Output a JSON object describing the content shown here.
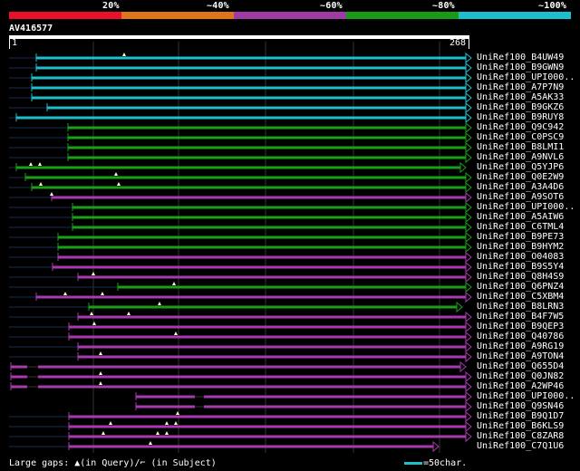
{
  "legend": {
    "labels": [
      "20%",
      "~40%",
      "~60%",
      "~80%",
      "~100%"
    ],
    "colors": [
      "#e8102a",
      "#e07418",
      "#a03aa4",
      "#189c18",
      "#1ebfcc"
    ]
  },
  "query": {
    "title": "AV416577",
    "start": "1",
    "end": "268"
  },
  "hits": [
    {
      "label": "UniRef100_B4UW49",
      "color": "cyan"
    },
    {
      "label": "UniRef100_B9GWN9",
      "color": "cyan"
    },
    {
      "label": "UniRef100_UPI000..",
      "color": "cyan"
    },
    {
      "label": "UniRef100_A7P7N9",
      "color": "cyan"
    },
    {
      "label": "UniRef100_A5AK33",
      "color": "cyan"
    },
    {
      "label": "UniRef100_B9GKZ6",
      "color": "cyan"
    },
    {
      "label": "UniRef100_B9RUY8",
      "color": "cyan"
    },
    {
      "label": "UniRef100_Q9C942",
      "color": "green"
    },
    {
      "label": "UniRef100_C0PSC9",
      "color": "green"
    },
    {
      "label": "UniRef100_B8LMI1",
      "color": "green"
    },
    {
      "label": "UniRef100_A9NVL6",
      "color": "green"
    },
    {
      "label": "UniRef100_Q5YJP6",
      "color": "green"
    },
    {
      "label": "UniRef100_Q0E2W9",
      "color": "green"
    },
    {
      "label": "UniRef100_A3A4D6",
      "color": "green"
    },
    {
      "label": "UniRef100_A9SOT6",
      "color": "purple"
    },
    {
      "label": "UniRef100_UPI000..",
      "color": "green"
    },
    {
      "label": "UniRef100_A5AIW6",
      "color": "green"
    },
    {
      "label": "UniRef100_C6TML4",
      "color": "green"
    },
    {
      "label": "UniRef100_B9PE73",
      "color": "green"
    },
    {
      "label": "UniRef100_B9HYM2",
      "color": "green"
    },
    {
      "label": "UniRef100_O04083",
      "color": "purple"
    },
    {
      "label": "UniRef100_B9S5Y4",
      "color": "purple"
    },
    {
      "label": "UniRef100_Q8H4S9",
      "color": "purple"
    },
    {
      "label": "UniRef100_Q6PNZ4",
      "color": "green"
    },
    {
      "label": "UniRef100_C5XBM4",
      "color": "purple"
    },
    {
      "label": "UniRef100_B8LRN3",
      "color": "green"
    },
    {
      "label": "UniRef100_B4F7W5",
      "color": "purple"
    },
    {
      "label": "UniRef100_B9QEP3",
      "color": "purple"
    },
    {
      "label": "UniRef100_Q40786",
      "color": "purple"
    },
    {
      "label": "UniRef100_A9RG19",
      "color": "purple"
    },
    {
      "label": "UniRef100_A9TON4",
      "color": "purple"
    },
    {
      "label": "UniRef100_Q655D4",
      "color": "purple"
    },
    {
      "label": "UniRef100_Q0JN82",
      "color": "purple"
    },
    {
      "label": "UniRef100_A2WP46",
      "color": "purple"
    },
    {
      "label": "UniRef100_UPI000..",
      "color": "purple"
    },
    {
      "label": "UniRef100_Q9SN46",
      "color": "purple"
    },
    {
      "label": "UniRef100_B9Q1D7",
      "color": "purple"
    },
    {
      "label": "UniRef100_B6KLS9",
      "color": "purple"
    },
    {
      "label": "UniRef100_C8ZAR8",
      "color": "purple"
    },
    {
      "label": "UniRef100_C7Q1U6",
      "color": "purple"
    }
  ],
  "footer": {
    "left": "Large gaps: ▲(in Query)/⌐ (in Subject)",
    "right": "=50char."
  }
}
